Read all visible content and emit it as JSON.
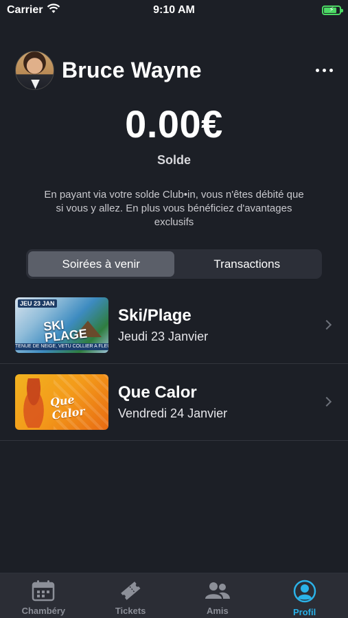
{
  "status_bar": {
    "carrier": "Carrier",
    "time": "9:10 AM"
  },
  "profile": {
    "name": "Bruce Wayne"
  },
  "balance": {
    "amount": "0.00€",
    "label": "Solde",
    "info": "En payant via votre solde Club•in, vous n'êtes débité que si vous y allez. En plus vous bénéficiez d'avantages exclusifs"
  },
  "segments": [
    {
      "label": "Soirées à venir",
      "active": true
    },
    {
      "label": "Transactions",
      "active": false
    }
  ],
  "events": [
    {
      "title": "Ski/Plage",
      "date": "Jeudi 23 Janvier",
      "thumb": {
        "date_text": "JEU 23 JAN",
        "title_text": "SKI PLAGE",
        "banner_text": "TENUE DE NEIGE, VETU COLLIER A FLEURS"
      }
    },
    {
      "title": "Que Calor",
      "date": "Vendredi 24 Janvier",
      "thumb": {
        "title_text": "Que Calor"
      }
    }
  ],
  "tab_bar": {
    "tabs": [
      {
        "label": "Chambéry",
        "icon": "calendar-icon",
        "active": false
      },
      {
        "label": "Tickets",
        "icon": "ticket-icon",
        "active": false
      },
      {
        "label": "Amis",
        "icon": "friends-icon",
        "active": false
      },
      {
        "label": "Profil",
        "icon": "profile-icon",
        "active": true
      }
    ],
    "active_color": "#2bb2e8",
    "inactive_color": "#8c8f98"
  }
}
